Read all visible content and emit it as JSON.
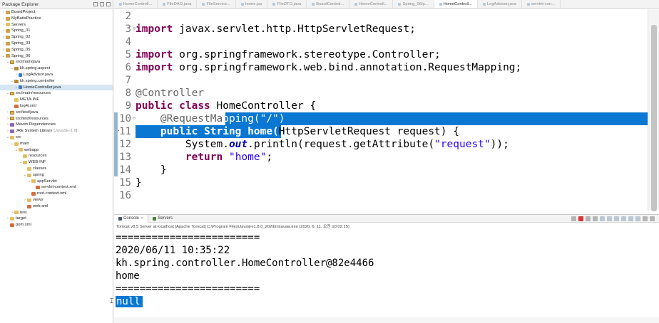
{
  "explorer": {
    "title": "Package Explorer",
    "items": [
      {
        "label": "BoardProject",
        "depth": 0,
        "arrow": "›",
        "icon": "project-icon"
      },
      {
        "label": "MyBatisPractice",
        "depth": 0,
        "arrow": "›",
        "icon": "project-icon"
      },
      {
        "label": "Servers",
        "depth": 0,
        "arrow": "›",
        "icon": "folder-icon"
      },
      {
        "label": "Spring_01",
        "depth": 0,
        "arrow": "›",
        "icon": "project-icon"
      },
      {
        "label": "Spring_02",
        "depth": 0,
        "arrow": "›",
        "icon": "project-icon"
      },
      {
        "label": "Spring_03",
        "depth": 0,
        "arrow": "›",
        "icon": "project-icon"
      },
      {
        "label": "Spring_05",
        "depth": 0,
        "arrow": "›",
        "icon": "project-icon"
      },
      {
        "label": "Spring_06",
        "depth": 0,
        "arrow": "⌄",
        "icon": "project-icon"
      },
      {
        "label": "src/main/java",
        "depth": 1,
        "arrow": "⌄",
        "icon": "source-folder-icon"
      },
      {
        "label": "kh.spring.aspect",
        "depth": 2,
        "arrow": "⌄",
        "icon": "package-icon"
      },
      {
        "label": "LogAdvisor.java",
        "depth": 3,
        "arrow": "›",
        "icon": "java-file-icon"
      },
      {
        "label": "kh.spring.controller",
        "depth": 2,
        "arrow": "⌄",
        "icon": "package-icon"
      },
      {
        "label": "HomeController.java",
        "depth": 3,
        "arrow": "›",
        "icon": "java-file-icon",
        "selected": true
      },
      {
        "label": "src/main/resources",
        "depth": 1,
        "arrow": "⌄",
        "icon": "source-folder-icon"
      },
      {
        "label": "META-INF",
        "depth": 2,
        "arrow": "",
        "icon": "folder-icon"
      },
      {
        "label": "log4j.xml",
        "depth": 2,
        "arrow": "",
        "icon": "xml-file-icon"
      },
      {
        "label": "src/test/java",
        "depth": 1,
        "arrow": "›",
        "icon": "source-folder-icon"
      },
      {
        "label": "src/test/resources",
        "depth": 1,
        "arrow": "›",
        "icon": "source-folder-icon"
      },
      {
        "label": "Maven Dependencies",
        "depth": 1,
        "arrow": "›",
        "icon": "library-icon"
      },
      {
        "label": "JRE System Library",
        "sub": "[JavaSE-1.8]",
        "depth": 1,
        "arrow": "›",
        "icon": "library-icon"
      },
      {
        "label": "src",
        "depth": 1,
        "arrow": "⌄",
        "icon": "folder-icon"
      },
      {
        "label": "main",
        "depth": 2,
        "arrow": "⌄",
        "icon": "folder-icon"
      },
      {
        "label": "webapp",
        "depth": 3,
        "arrow": "⌄",
        "icon": "folder-icon"
      },
      {
        "label": "resources",
        "depth": 4,
        "arrow": "",
        "icon": "folder-icon"
      },
      {
        "label": "WEB-INF",
        "depth": 4,
        "arrow": "⌄",
        "icon": "folder-icon"
      },
      {
        "label": "classes",
        "depth": 5,
        "arrow": "",
        "icon": "folder-icon"
      },
      {
        "label": "spring",
        "depth": 5,
        "arrow": "⌄",
        "icon": "folder-icon"
      },
      {
        "label": "appServlet",
        "depth": 6,
        "arrow": "⌄",
        "icon": "folder-icon"
      },
      {
        "label": "servlet-context.xml",
        "depth": 7,
        "arrow": "",
        "icon": "xml-file-icon"
      },
      {
        "label": "root-context.xml",
        "depth": 6,
        "arrow": "",
        "icon": "xml-file-icon"
      },
      {
        "label": "views",
        "depth": 5,
        "arrow": "›",
        "icon": "folder-icon"
      },
      {
        "label": "web.xml",
        "depth": 5,
        "arrow": "",
        "icon": "xml-file-icon"
      },
      {
        "label": "test",
        "depth": 2,
        "arrow": "›",
        "icon": "folder-icon"
      },
      {
        "label": "target",
        "depth": 1,
        "arrow": "›",
        "icon": "folder-icon"
      },
      {
        "label": "pom.xml",
        "depth": 1,
        "arrow": "",
        "icon": "xml-file-icon"
      }
    ]
  },
  "tabs": [
    {
      "label": "HomeControll...",
      "active": false
    },
    {
      "label": "FileDAO.java",
      "active": false
    },
    {
      "label": "FileService...",
      "active": false
    },
    {
      "label": "home.jsp",
      "active": false
    },
    {
      "label": "FileDTO.java",
      "active": false
    },
    {
      "label": "BoardControl...",
      "active": false
    },
    {
      "label": "HomeControll...",
      "active": false
    },
    {
      "label": "Spring_06/p...",
      "active": false
    },
    {
      "label": "HomeControll...",
      "active": true
    },
    {
      "label": "LogAdvisor.java",
      "active": false
    },
    {
      "label": "servlet-con...",
      "active": false
    }
  ],
  "editor": {
    "lines": [
      {
        "num": "2",
        "tokens": []
      },
      {
        "num": "3",
        "fold": "⊖",
        "changed": false,
        "tokens": [
          {
            "t": "import",
            "c": "kw"
          },
          {
            "t": " javax.servlet.http.HttpServletRequest;",
            "c": ""
          }
        ]
      },
      {
        "num": "4",
        "tokens": []
      },
      {
        "num": "5",
        "tokens": [
          {
            "t": "import",
            "c": "kw"
          },
          {
            "t": " org.springframework.stereotype.Controller;",
            "c": ""
          }
        ]
      },
      {
        "num": "6",
        "tokens": [
          {
            "t": "import",
            "c": "kw"
          },
          {
            "t": " org.springframework.web.bind.annotation.RequestMapping;",
            "c": ""
          }
        ]
      },
      {
        "num": "7",
        "tokens": []
      },
      {
        "num": "8",
        "tokens": [
          {
            "t": "@Controller",
            "c": "ann"
          }
        ]
      },
      {
        "num": "9",
        "tokens": [
          {
            "t": "public",
            "c": "kw"
          },
          {
            "t": " ",
            "c": ""
          },
          {
            "t": "class",
            "c": "kw"
          },
          {
            "t": " HomeController {",
            "c": ""
          }
        ]
      },
      {
        "num": "10",
        "fold": "⊖",
        "changed": true,
        "sel": "partial",
        "tokens": [
          {
            "t": "    @RequestMa",
            "c": "ann"
          },
          {
            "t": "pping(\"/\")",
            "c": "selected"
          }
        ]
      },
      {
        "num": "11",
        "changed": true,
        "marker": true,
        "sel": "lead",
        "tokens": [
          {
            "t": "    public String home(",
            "c": "selected-kw"
          },
          {
            "t": "HttpServletRequest ",
            "c": ""
          },
          {
            "t": "request",
            "c": ""
          },
          {
            "t": ") {",
            "c": ""
          }
        ]
      },
      {
        "num": "12",
        "changed": true,
        "tokens": [
          {
            "t": "        System.",
            "c": ""
          },
          {
            "t": "out",
            "c": "fld"
          },
          {
            "t": ".println(request.getAttribute(",
            "c": ""
          },
          {
            "t": "\"request\"",
            "c": "str"
          },
          {
            "t": "));",
            "c": ""
          }
        ]
      },
      {
        "num": "13",
        "changed": true,
        "tokens": [
          {
            "t": "        ",
            "c": ""
          },
          {
            "t": "return",
            "c": "kw"
          },
          {
            "t": " ",
            "c": ""
          },
          {
            "t": "\"home\"",
            "c": "str"
          },
          {
            "t": ";",
            "c": ""
          }
        ]
      },
      {
        "num": "14",
        "changed": true,
        "tokens": [
          {
            "t": "    }",
            "c": ""
          }
        ]
      },
      {
        "num": "15",
        "tokens": [
          {
            "t": "}",
            "c": ""
          }
        ]
      },
      {
        "num": "16",
        "tokens": []
      }
    ]
  },
  "console": {
    "tab_console": "Console",
    "tab_servers": "Servers",
    "info": "Tomcat v8.5 Server at localhost [Apache Tomcat] C:\\Program Files\\Java\\jre1.8.0_202\\bin\\javaw.exe (2020. 6. 11. 오전 10:02:15)",
    "output": [
      "========================",
      "2020/06/11 10:35:22",
      "kh.spring.controller.HomeController@82e4466",
      "home",
      "========================",
      "null"
    ]
  },
  "colors": {
    "selection": "#0a77d2",
    "keyword": "#7f0055",
    "string": "#2a00ff",
    "annotation": "#646464"
  }
}
